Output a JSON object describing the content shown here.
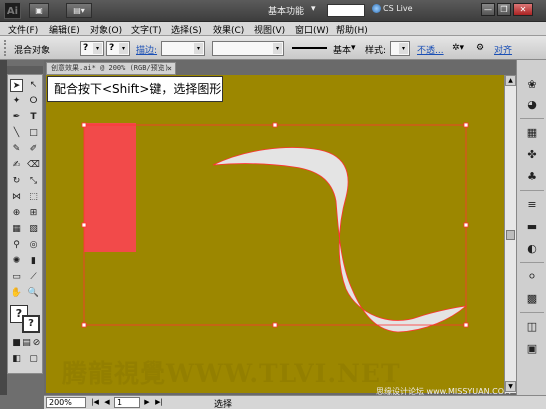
{
  "titlebar": {
    "logo": "Ai",
    "workspace": "基本功能",
    "cs_live": "CS Live",
    "minimize": "—",
    "restore": "❐",
    "close": "✕"
  },
  "menu": [
    "文件(F)",
    "编辑(E)",
    "对象(O)",
    "文字(T)",
    "选择(S)",
    "效果(C)",
    "视图(V)",
    "窗口(W)",
    "帮助(H)"
  ],
  "controlbar": {
    "object_label": "混合对象",
    "fill_q": "?",
    "stroke_q": "?",
    "stroke_label": "描边:",
    "brush_label": "基本",
    "style_label": "样式:",
    "opacity_label": "不透...",
    "align_label": "对齐"
  },
  "document": {
    "tab_title": "创意效果.ai* @ 200% (RGB/预览)",
    "tab_close": "×"
  },
  "tooltip": {
    "text": "配合按下<Shift>键，选择图形"
  },
  "watermark": {
    "main": "腾龍視覺WWW.TLVI.NET",
    "sub": "思缘设计论坛 www.MISSYUAN.COM"
  },
  "statusbar": {
    "zoom": "200%",
    "page": "1",
    "current_tool": "选择"
  },
  "colors": {
    "canvas": "#9c8700",
    "rect_fill": "#f24a4a",
    "shape_fill": "#e4e4e4",
    "selection": "#ff3333"
  }
}
